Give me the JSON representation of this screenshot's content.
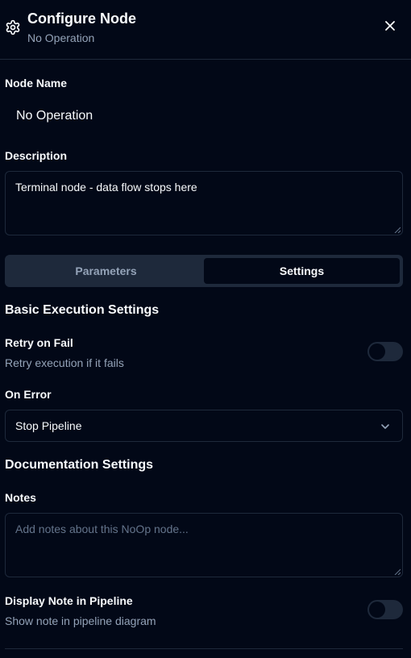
{
  "header": {
    "title": "Configure Node",
    "subtitle": "No Operation",
    "icon": "gear-icon",
    "close_icon": "close-icon"
  },
  "node_name": {
    "label": "Node Name",
    "value": "No Operation"
  },
  "description": {
    "label": "Description",
    "value": "Terminal node - data flow stops here"
  },
  "tabs": [
    {
      "label": "Parameters",
      "active": false
    },
    {
      "label": "Settings",
      "active": true
    }
  ],
  "basic_execution": {
    "title": "Basic Execution Settings",
    "retry": {
      "label": "Retry on Fail",
      "description": "Retry execution if it fails",
      "enabled": false
    },
    "on_error": {
      "label": "On Error",
      "selected": "Stop Pipeline"
    }
  },
  "documentation": {
    "title": "Documentation Settings",
    "notes": {
      "label": "Notes",
      "placeholder": "Add notes about this NoOp node..."
    },
    "display_note": {
      "label": "Display Note in Pipeline",
      "description": "Show note in pipeline diagram",
      "enabled": false
    }
  },
  "colors": {
    "background": "#020817",
    "border": "#1e293b",
    "muted_text": "#94a3b8",
    "text": "#f8fafc"
  }
}
